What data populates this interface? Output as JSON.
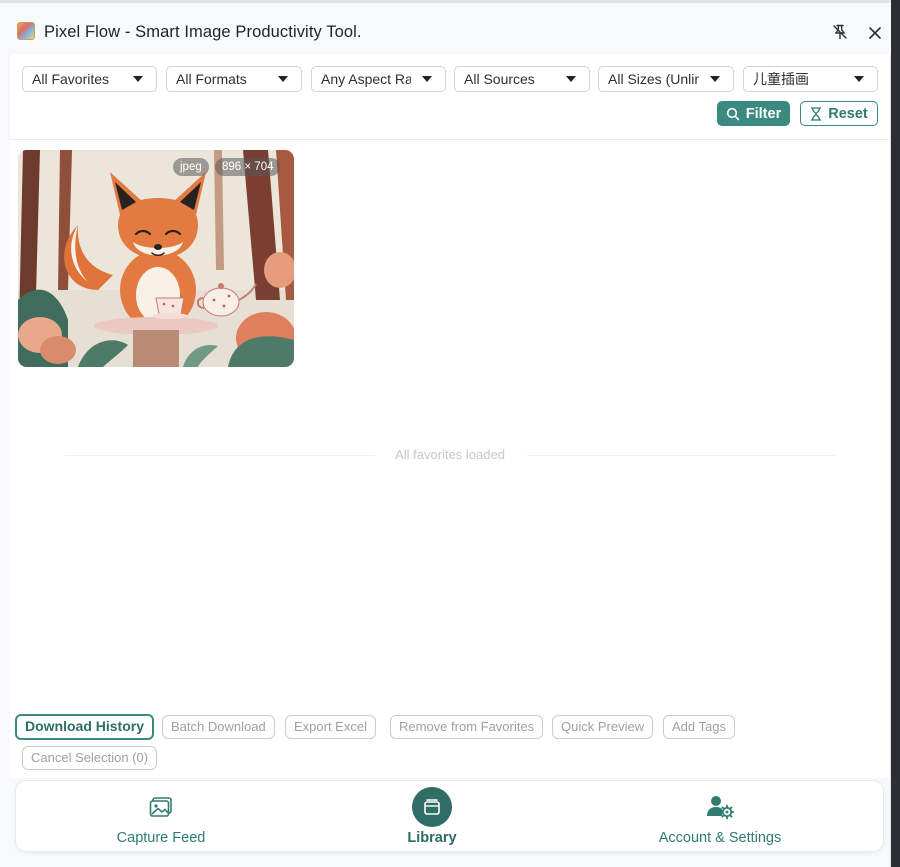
{
  "header": {
    "title": "Pixel Flow - Smart Image Productivity Tool.",
    "pin_icon": "unpin-icon",
    "close_icon": "close-icon"
  },
  "filters": {
    "favorites": "All Favorites",
    "formats": "All Formats",
    "aspect": "Any Aspect Ra",
    "sources": "All Sources",
    "sizes": "All Sizes (Unlir",
    "tag": "儿童插画",
    "filter_label": "Filter",
    "reset_label": "Reset"
  },
  "gallery": {
    "items": [
      {
        "format": "jpeg",
        "dimensions": "896 × 704"
      }
    ],
    "end_message": "All favorites loaded"
  },
  "actions": {
    "download_history": "Download History",
    "batch_download": "Batch Download",
    "export_excel": "Export Excel",
    "remove_favorites": "Remove from Favorites",
    "quick_preview": "Quick Preview",
    "add_tags": "Add Tags",
    "cancel_selection": "Cancel Selection (0)"
  },
  "nav": {
    "capture_feed": "Capture Feed",
    "library": "Library",
    "account_settings": "Account & Settings",
    "active": "library"
  },
  "colors": {
    "accent": "#3a8a7f",
    "accent_dark": "#2f6e67"
  }
}
